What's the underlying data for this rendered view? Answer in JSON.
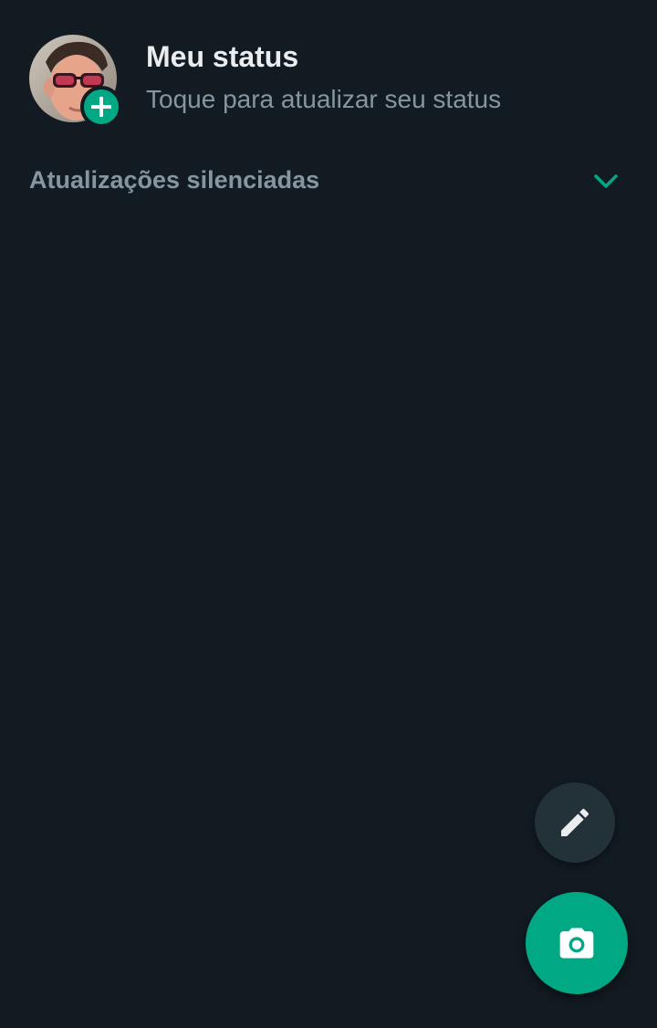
{
  "my_status": {
    "title": "Meu status",
    "subtitle": "Toque para atualizar seu status",
    "avatar_icon": "user-avatar",
    "badge_icon": "plus-icon"
  },
  "muted_updates": {
    "label": "Atualizações silenciadas",
    "toggle_icon": "chevron-down-icon",
    "expanded": false
  },
  "fabs": {
    "edit_icon": "pencil-icon",
    "camera_icon": "camera-icon"
  },
  "colors": {
    "background": "#121b22",
    "accent": "#00a884",
    "primary_text": "#e9edef",
    "secondary_text": "#8696a0",
    "fab_secondary": "#233138"
  }
}
